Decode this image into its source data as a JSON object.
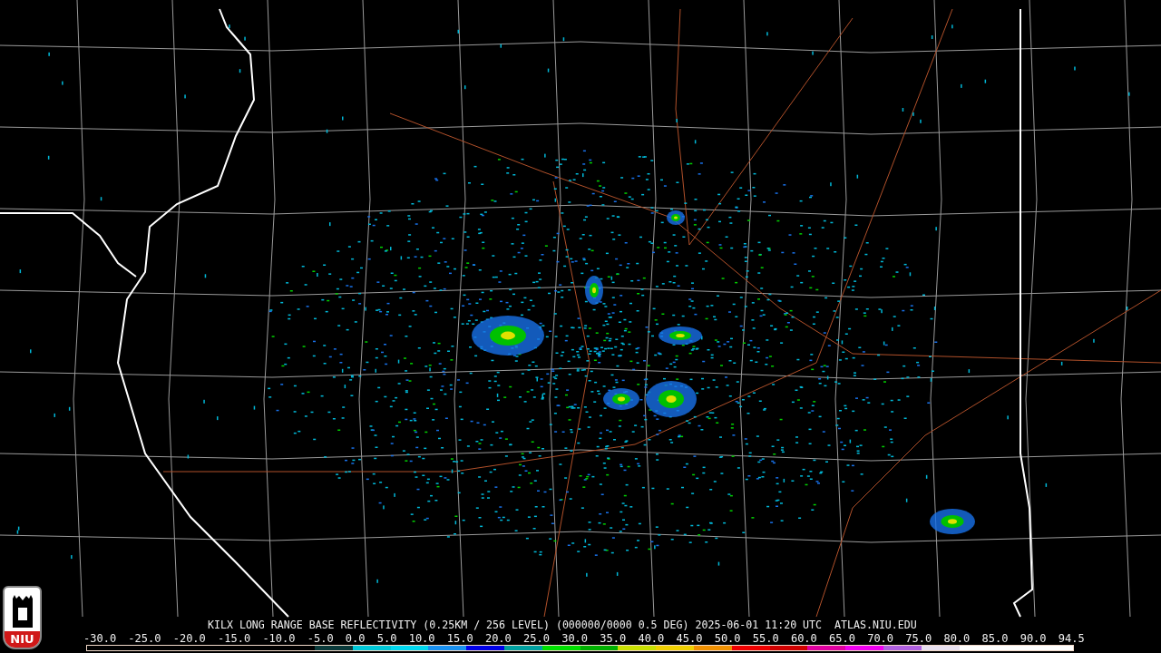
{
  "logo": {
    "text": "NIU"
  },
  "caption": "KILX LONG RANGE BASE REFLECTIVITY (0.25KM / 256 LEVEL) (000000/0000 0.5 DEG) 2025-06-01 11:20 UTC  ATLAS.NIU.EDU",
  "scale_labels": [
    "-30.0",
    "-25.0",
    "-20.0",
    "-15.0",
    "-10.0",
    "-5.0",
    "0.0",
    "5.0",
    "10.0",
    "15.0",
    "20.0",
    "25.0",
    "30.0",
    "35.0",
    "40.0",
    "45.0",
    "50.0",
    "55.0",
    "60.0",
    "65.0",
    "70.0",
    "75.0",
    "80.0",
    "85.0",
    "90.0",
    "94.5"
  ]
}
